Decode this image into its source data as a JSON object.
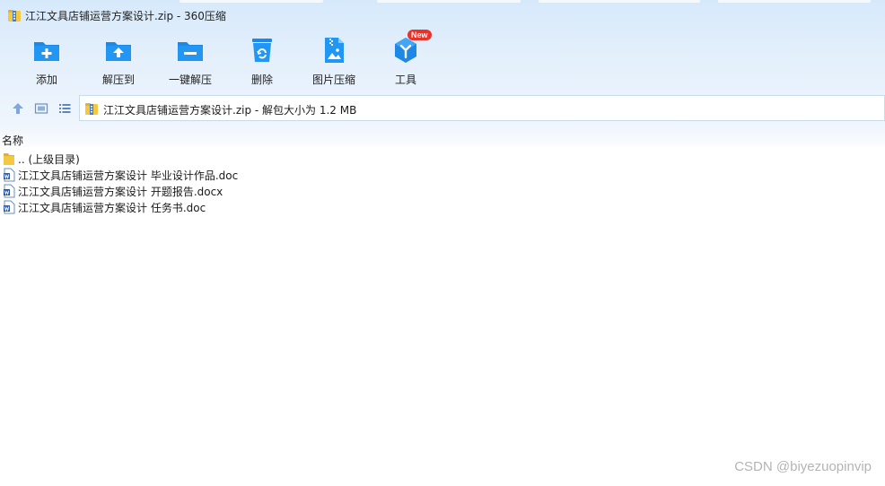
{
  "window": {
    "title": "江江文具店铺运营方案设计.zip - 360压缩"
  },
  "toolbar": {
    "items": [
      {
        "label": "添加",
        "icon": "add-folder-icon"
      },
      {
        "label": "解压到",
        "icon": "extract-to-icon"
      },
      {
        "label": "一键解压",
        "icon": "one-click-extract-icon"
      },
      {
        "label": "删除",
        "icon": "recycle-bin-icon"
      },
      {
        "label": "图片压缩",
        "icon": "image-compress-icon"
      },
      {
        "label": "工具",
        "icon": "tools-icon"
      }
    ],
    "new_badge": "New"
  },
  "nav": {
    "address": "江江文具店铺运营方案设计.zip - 解包大小为 1.2 MB"
  },
  "list": {
    "column_name": "名称",
    "rows": [
      {
        "name": ".. (上级目录)",
        "type": "folder"
      },
      {
        "name": "江江文具店铺运营方案设计 毕业设计作品.doc",
        "type": "doc"
      },
      {
        "name": "江江文具店铺运营方案设计 开题报告.docx",
        "type": "docx"
      },
      {
        "name": "江江文具店铺运营方案设计 任务书.doc",
        "type": "doc"
      }
    ]
  },
  "watermark": "CSDN @biyezuopinvip",
  "colors": {
    "accent": "#1e88e5",
    "icon_blue": "#2196f3",
    "badge_red": "#e8332a",
    "folder_yellow": "#f5c842"
  }
}
